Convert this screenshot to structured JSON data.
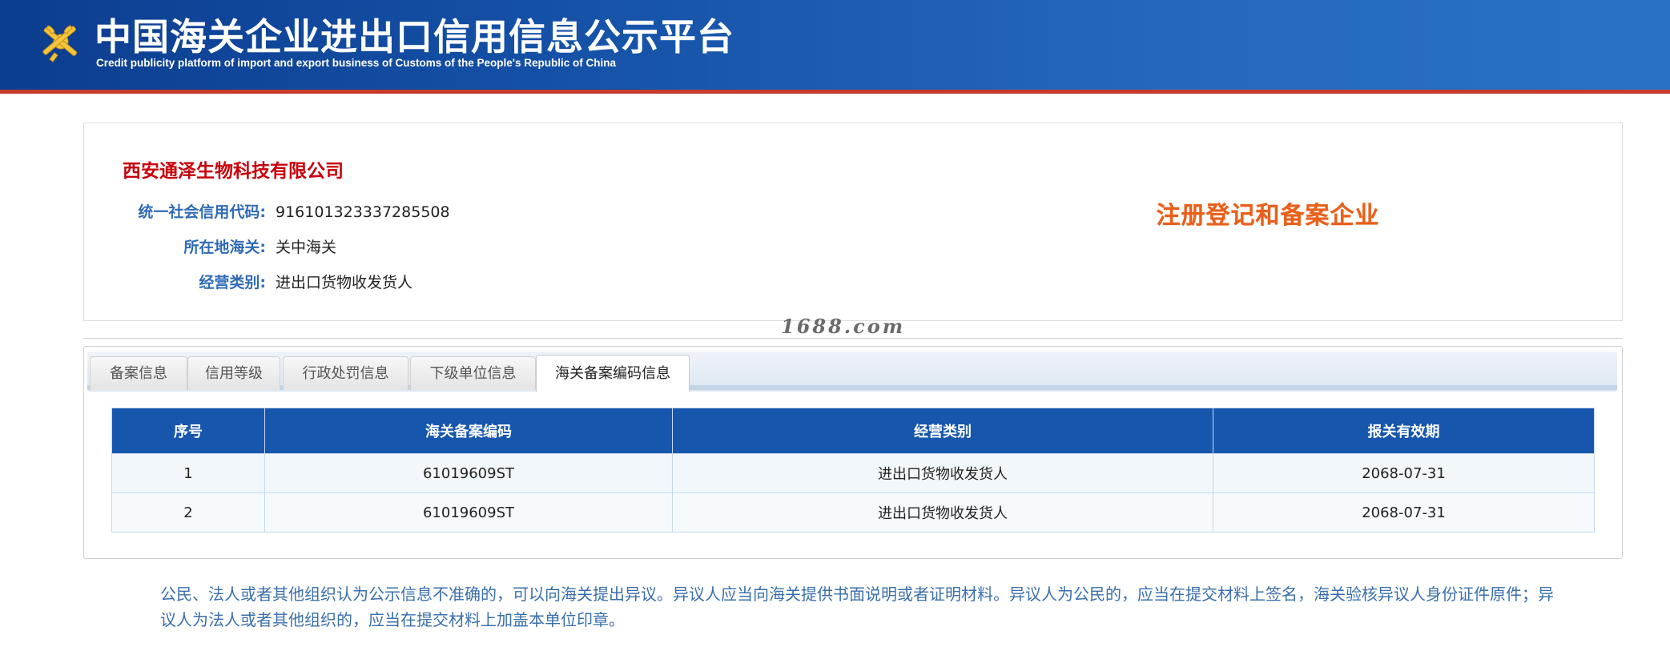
{
  "header": {
    "title": "中国海关企业进出口信用信息公示平台",
    "subtitle": "Credit publicity platform of import and export business of Customs of the People's Republic of China",
    "logo_icon": "customs-emblem-icon"
  },
  "company": {
    "name": "西安通泽生物科技有限公司",
    "credit_code_label": "统一社会信用代码:",
    "credit_code_value": "916101323337285508",
    "customs_label": "所在地海关:",
    "customs_value": "关中海关",
    "business_type_label": "经营类别:",
    "business_type_value": "进出口货物收发货人",
    "status_stamp": "注册登记和备案企业"
  },
  "watermark": "1688.com",
  "tabs": [
    {
      "label": "备案信息",
      "active": false
    },
    {
      "label": "信用等级",
      "active": false
    },
    {
      "label": "行政处罚信息",
      "active": false
    },
    {
      "label": "下级单位信息",
      "active": false
    },
    {
      "label": "海关备案编码信息",
      "active": true
    }
  ],
  "table": {
    "headers": [
      "序号",
      "海关备案编码",
      "经营类别",
      "报关有效期"
    ],
    "rows": [
      [
        "1",
        "61019609ST",
        "进出口货物收发货人",
        "2068-07-31"
      ],
      [
        "2",
        "61019609ST",
        "进出口货物收发货人",
        "2068-07-31"
      ]
    ]
  },
  "notice": "公民、法人或者其他组织认为公示信息不准确的，可以向海关提出异议。异议人应当向海关提供书面说明或者证明材料。异议人为公民的，应当在提交材料上签名，海关验核异议人身份证件原件；异议人为法人或者其他组织的，应当在提交材料上加盖本单位印章。",
  "colors": {
    "header_bg": "#1552a8",
    "accent_red": "#c8000a",
    "label_blue": "#2f6bb5",
    "table_header": "#1756ad",
    "stamp_orange": "#e8601c"
  }
}
